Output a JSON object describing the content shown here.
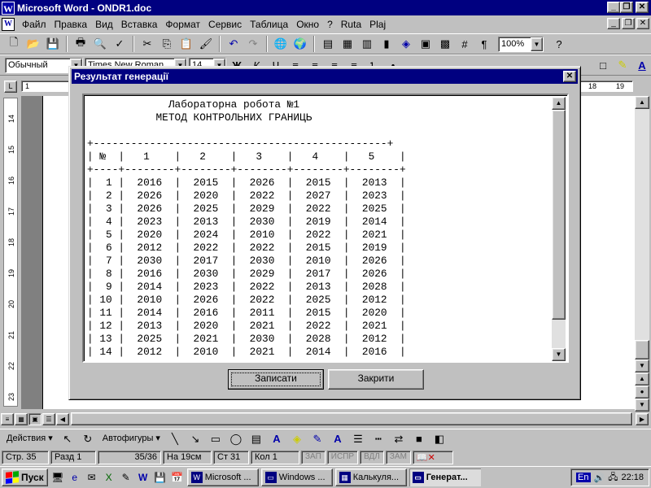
{
  "app": {
    "title": "Microsoft Word - ONDR1.doc",
    "window_buttons": [
      "_",
      "❐",
      "✕"
    ]
  },
  "menu": [
    "Файл",
    "Правка",
    "Вид",
    "Вставка",
    "Формат",
    "Сервис",
    "Таблица",
    "Окно",
    "?",
    "Ruta",
    "Plaj"
  ],
  "toolbar": {
    "zoom": "100%",
    "style": "Обычный",
    "font": "Times New Roman",
    "size": "14"
  },
  "ruler": {
    "h_marks": [
      "1",
      "18",
      "19"
    ],
    "v_marks": [
      "14",
      "15",
      "16",
      "17",
      "18",
      "19",
      "20",
      "21",
      "22",
      "23"
    ]
  },
  "dialog": {
    "title": "Результат генерації",
    "report_lines": [
      "             Лабораторна робота №1",
      "           МЕТОД КОНТРОЛЬНИХ ГРАНИЦЬ",
      "",
      "+-----------------------------------------------+",
      "| №  |   1    |   2    |   3    |   4    |   5    |",
      "+----+--------+--------+--------+--------+--------+",
      "|  1 |  2016  |  2015  |  2026  |  2015  |  2013  |",
      "|  2 |  2026  |  2020  |  2022  |  2027  |  2023  |",
      "|  3 |  2026  |  2025  |  2029  |  2022  |  2025  |",
      "|  4 |  2023  |  2013  |  2030  |  2019  |  2014  |",
      "|  5 |  2020  |  2024  |  2010  |  2022  |  2021  |",
      "|  6 |  2012  |  2022  |  2022  |  2015  |  2019  |",
      "|  7 |  2030  |  2017  |  2030  |  2010  |  2026  |",
      "|  8 |  2016  |  2030  |  2029  |  2017  |  2026  |",
      "|  9 |  2014  |  2023  |  2022  |  2013  |  2028  |",
      "| 10 |  2010  |  2026  |  2022  |  2025  |  2012  |",
      "| 11 |  2014  |  2016  |  2011  |  2015  |  2020  |",
      "| 12 |  2013  |  2020  |  2021  |  2022  |  2021  |",
      "| 13 |  2025  |  2021  |  2030  |  2028  |  2012  |",
      "| 14 |  2012  |  2010  |  2021  |  2014  |  2016  |"
    ],
    "save_label": "Записати",
    "close_label": "Закрити"
  },
  "drawbar": {
    "actions_label": "Действия",
    "autoshapes_label": "Автофигуры"
  },
  "status": {
    "page": "Стр. 35",
    "section": "Разд 1",
    "pages": "35/36",
    "at": "На 19см",
    "line": "Ст 31",
    "col": "Кол 1",
    "indicators": [
      "ЗАП",
      "ИСПР",
      "ВДЛ",
      "ЗАМ"
    ]
  },
  "taskbar": {
    "start_label": "Пуск",
    "tasks": [
      "Microsoft ...",
      "Windows ...",
      "Калькуля...",
      "Генерат..."
    ],
    "active_task": "Генерат...",
    "language": "En",
    "clock": "22:18"
  },
  "colors": {
    "titlebar": "#000080",
    "face": "#c0c0c0"
  }
}
